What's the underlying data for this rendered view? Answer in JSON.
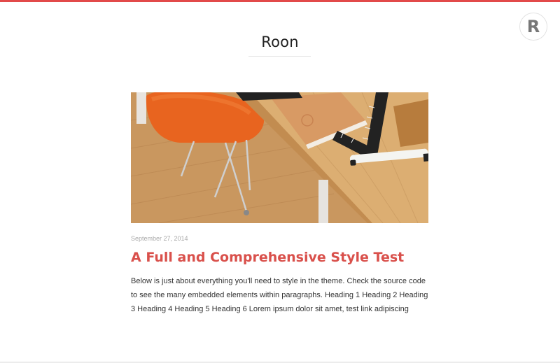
{
  "site": {
    "title": "Roon",
    "logo_letter": "R"
  },
  "post": {
    "date": "September 27, 2014",
    "title": "A Full and Comprehensive Style Test",
    "excerpt": "Below is just about everything you'll need to style in the theme. Check the source code to see the many embedded elements within paragraphs. Heading 1 Heading 2 Heading 3 Heading 4 Heading 5 Heading 6 Lorem ipsum dolor sit amet, test link adipiscing",
    "image_icon": "desk-photo"
  },
  "colors": {
    "accent": "#e24a4a",
    "post_title": "#d9504b",
    "text": "#333333",
    "muted": "#a9a9a9"
  }
}
